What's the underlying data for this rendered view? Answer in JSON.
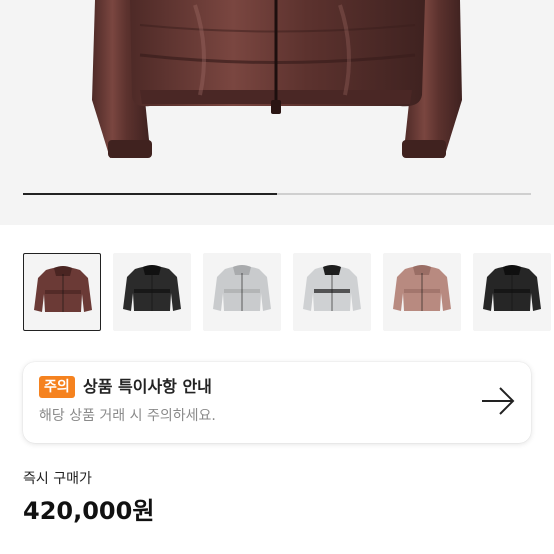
{
  "gallery": {
    "progress_fraction": 0.5,
    "thumbnails": [
      {
        "name": "jacket-brown",
        "color": "#6b3a36",
        "accent": "#4a2522",
        "selected": true
      },
      {
        "name": "jacket-black-gloss",
        "color": "#2b2b2b",
        "accent": "#111111",
        "selected": false
      },
      {
        "name": "jacket-silver",
        "color": "#c9cbcd",
        "accent": "#a9abad",
        "selected": false
      },
      {
        "name": "jacket-silver-black",
        "color": "#cfd1d3",
        "accent": "#1e1e1e",
        "selected": false
      },
      {
        "name": "jacket-pink",
        "color": "#b88a80",
        "accent": "#9a6e65",
        "selected": false
      },
      {
        "name": "jacket-black",
        "color": "#262626",
        "accent": "#0f0f0f",
        "selected": false
      }
    ]
  },
  "notice": {
    "badge": "주의",
    "title": "상품 특이사항 안내",
    "description": "해당 상품 거래 시 주의하세요.",
    "arrow_icon": "arrow-right-icon"
  },
  "purchase": {
    "label": "즉시 구매가",
    "price": "420,000원"
  }
}
